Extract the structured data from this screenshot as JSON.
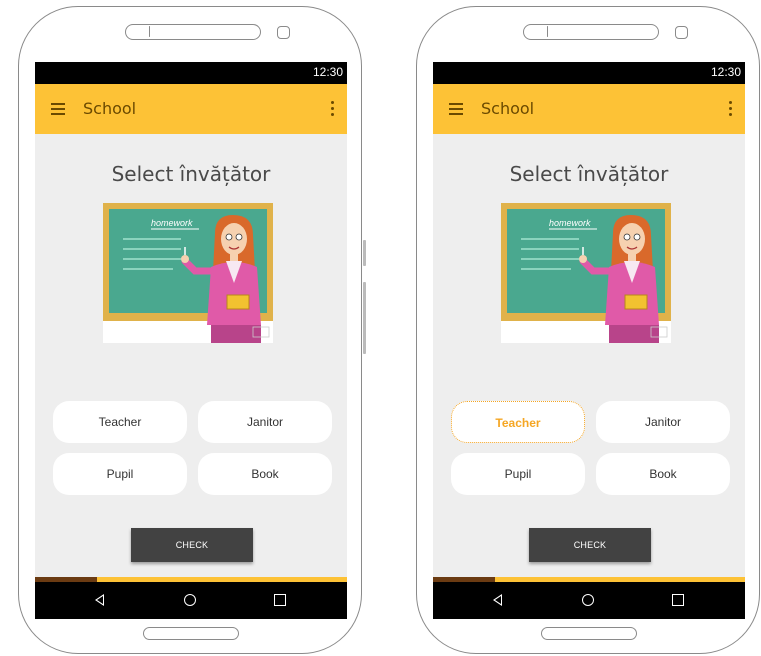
{
  "status": {
    "time": "12:30"
  },
  "app": {
    "title": "School"
  },
  "question": {
    "prompt": "Select învățător"
  },
  "illustration": {
    "board_text": "homework"
  },
  "options": [
    "Teacher",
    "Janitor",
    "Pupil",
    "Book"
  ],
  "selected_option_right_screen": "Teacher",
  "check_button": {
    "label": "CHECK"
  },
  "progress": {
    "fraction": 0.2
  },
  "colors": {
    "appbar": "#fdc236",
    "accent": "#f5a623",
    "progress_fill": "#6b3b12",
    "button": "#424242"
  },
  "icons": {
    "menu": "hamburger-menu-icon",
    "more": "more-vert-icon",
    "back": "nav-back-icon",
    "home": "nav-home-icon",
    "recent": "nav-recent-icon"
  }
}
